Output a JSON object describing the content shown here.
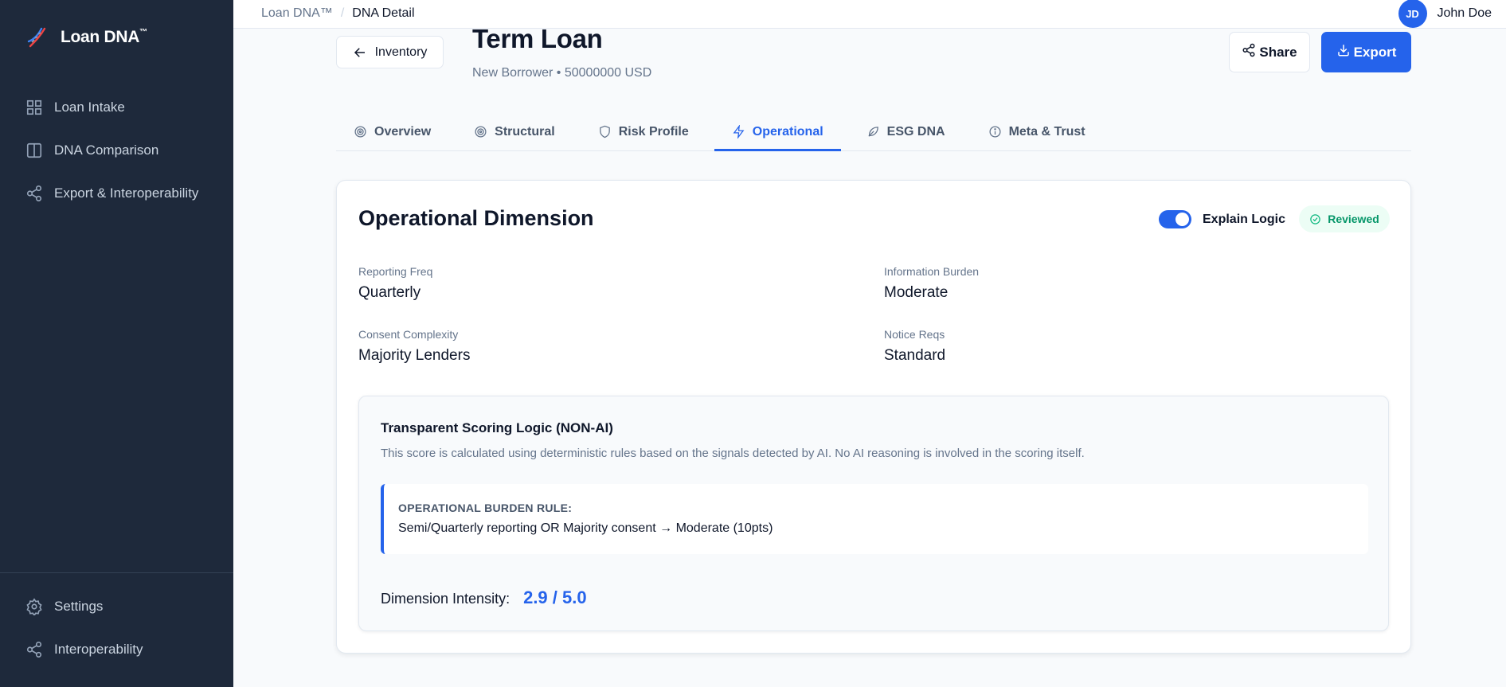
{
  "brand": {
    "name": "Loan DNA",
    "mark": "™"
  },
  "sidebar": {
    "items": [
      {
        "label": "Loan Intake",
        "icon": "grid-icon"
      },
      {
        "label": "DNA Comparison",
        "icon": "columns-icon"
      },
      {
        "label": "Export & Interoperability",
        "icon": "share-nodes-icon"
      }
    ],
    "bottom_items": [
      {
        "label": "Settings",
        "icon": "gear-icon"
      },
      {
        "label": "Interoperability",
        "icon": "share-nodes-icon"
      }
    ]
  },
  "topbar": {
    "breadcrumb_root": "Loan DNA™",
    "breadcrumb_sep": "/",
    "breadcrumb_current": "DNA Detail",
    "user_initials": "JD",
    "user_name": "John Doe"
  },
  "header": {
    "back_label": "Inventory",
    "title": "Term Loan",
    "subtitle": "New Borrower • 50000000 USD",
    "share_label": "Share",
    "export_label": "Export"
  },
  "tabs": [
    {
      "label": "Overview",
      "icon": "target-icon"
    },
    {
      "label": "Structural",
      "icon": "target-icon"
    },
    {
      "label": "Risk Profile",
      "icon": "shield-icon"
    },
    {
      "label": "Operational",
      "icon": "lightning-icon",
      "active": true
    },
    {
      "label": "ESG DNA",
      "icon": "leaf-icon"
    },
    {
      "label": "Meta & Trust",
      "icon": "info-icon"
    }
  ],
  "card": {
    "title": "Operational Dimension",
    "toggle_label": "Explain Logic",
    "toggle_on": true,
    "badge": "Reviewed",
    "fields": [
      {
        "label": "Reporting Freq",
        "value": "Quarterly"
      },
      {
        "label": "Information Burden",
        "value": "Moderate"
      },
      {
        "label": "Consent Complexity",
        "value": "Majority Lenders"
      },
      {
        "label": "Notice Reqs",
        "value": "Standard"
      }
    ],
    "logic": {
      "title": "Transparent Scoring Logic (NON-AI)",
      "description": "This score is calculated using deterministic rules based on the signals detected by AI. No AI reasoning is involved in the scoring itself.",
      "rule_title": "OPERATIONAL BURDEN RULE:",
      "rule_text": "Semi/Quarterly reporting OR Majority consent → Moderate (10pts)",
      "intensity_label": "Dimension Intensity:",
      "intensity_value": "2.9 / 5.0"
    }
  },
  "colors": {
    "sidebar": "#1e293b",
    "accent": "#2563eb",
    "success": "#059669"
  }
}
